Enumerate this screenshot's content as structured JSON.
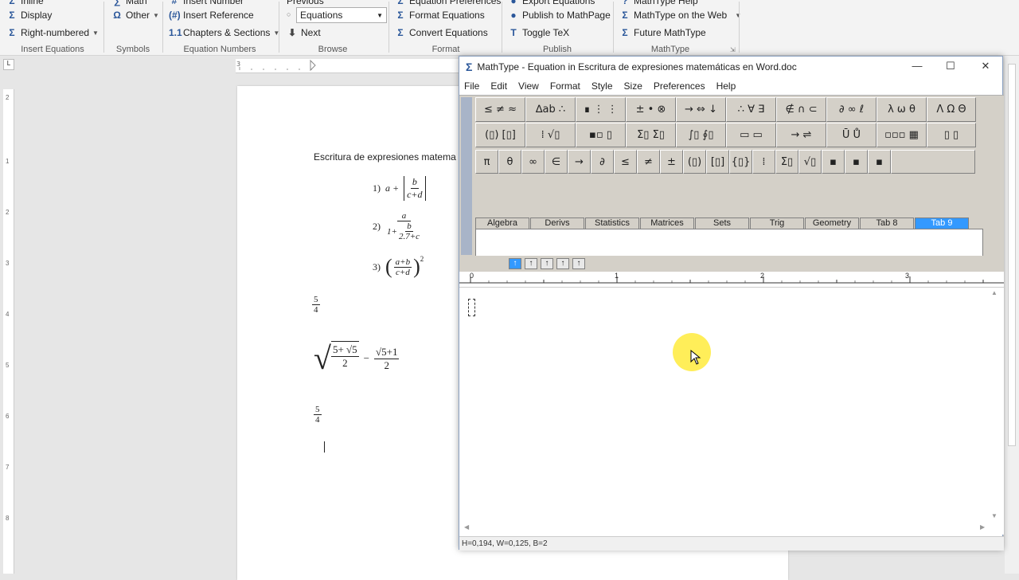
{
  "ribbon": {
    "insert_equations": {
      "inline": "Inline",
      "display": "Display",
      "right_numbered": "Right-numbered",
      "group": "Insert Equations"
    },
    "symbols": {
      "other": "Other",
      "group": "Symbols"
    },
    "equation_numbers": {
      "insert_number": "Insert Number",
      "insert_reference": "Insert Reference",
      "chapters_sections": "Chapters & Sections",
      "group": "Equation Numbers"
    },
    "browse": {
      "previous": "Previous",
      "select_value": "Equations",
      "next": "Next",
      "group": "Browse"
    },
    "format": {
      "equation_preferences": "Equation Preferences",
      "format_equations": "Format Equations",
      "convert_equations": "Convert Equations",
      "group": "Format"
    },
    "publish": {
      "export_equations": "Export Equations",
      "publish_mathpage": "Publish to MathPage",
      "toggle_tex": "Toggle TeX",
      "group": "Publish"
    },
    "mathtype": {
      "help": "MathType Help",
      "on_web": "MathType on the Web",
      "future": "Future MathType",
      "group": "MathType"
    }
  },
  "document": {
    "heading": "Escritura de expresiones matema",
    "eq1_label": "1)",
    "eq1_a": "a +",
    "eq1_num": "b",
    "eq1_den": "c+d",
    "eq2_label": "2)",
    "eq2_num": "a",
    "eq2_den_prefix": "1+",
    "eq2_inner_num": "b",
    "eq2_inner_den": "2.7+c",
    "eq3_label": "3)",
    "eq3_num": "a+b",
    "eq3_den": "c+d",
    "eq3_exp": "2",
    "frac1_num": "5",
    "frac1_den": "4",
    "rad_num": "5+ √5",
    "rad_den": "2",
    "minus": "−",
    "frac2_num": "√5+1",
    "frac2_den": "2",
    "frac3_num": "5",
    "frac3_den": "4"
  },
  "mathtype": {
    "title": "MathType - Equation in Escritura de expresiones matemáticas en Word.doc",
    "menu": [
      "File",
      "Edit",
      "View",
      "Format",
      "Style",
      "Size",
      "Preferences",
      "Help"
    ],
    "palette_row1": [
      "≤ ≠ ≈",
      "∆ab ∴",
      "∎ ⋮ ⋮",
      "± • ⊗",
      "→ ⇔ ↓",
      "∴ ∀ ∃",
      "∉ ∩ ⊂",
      "∂ ∞ ℓ",
      "λ ω θ",
      "Λ Ω Θ"
    ],
    "palette_row2": [
      "(▯) [▯]",
      "⁞ √▯",
      "▪▫ ▯",
      "Σ▯ Σ▯",
      "∫▯ ∮▯",
      "▭ ▭",
      "→ ⇌",
      "Ū Ů",
      "▫▫▫ ▦",
      "▯ ▯"
    ],
    "palette_row3": [
      "π",
      "θ",
      "∞",
      "∈",
      "→",
      "∂",
      "≤",
      "≠",
      "±",
      "(▯)",
      "[▯]",
      "{▯}",
      "⁞",
      "Σ▯",
      "√▯",
      "▪",
      "▪",
      "▪"
    ],
    "tabs": [
      "Algebra",
      "Derivs",
      "Statistics",
      "Matrices",
      "Sets",
      "Trig",
      "Geometry",
      "Tab 8",
      "Tab 9"
    ],
    "active_tab": "Tab 9",
    "ruler_labels": [
      "0",
      "1",
      "2",
      "3"
    ],
    "status": "H=0,194, W=0,125, B=2"
  }
}
